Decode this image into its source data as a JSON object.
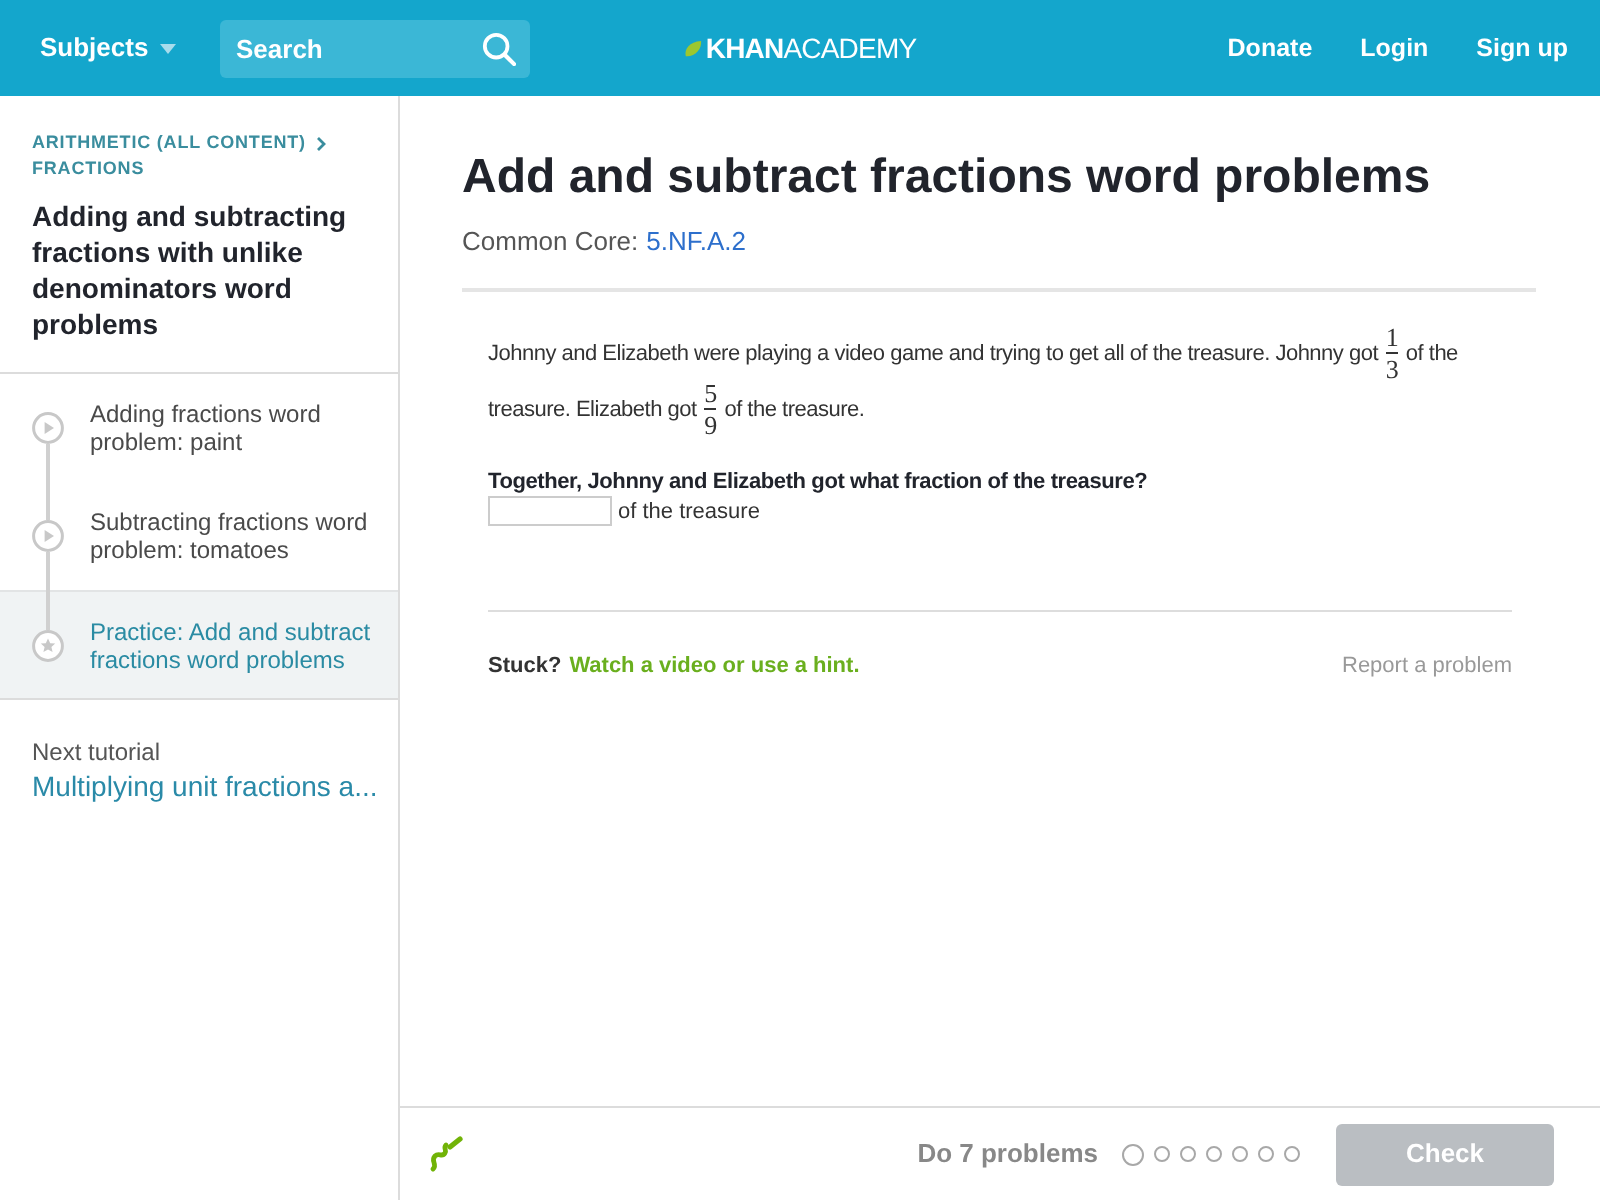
{
  "header": {
    "subjects": "Subjects",
    "search": {
      "placeholder": "Search"
    },
    "logo": "**KHAN**ACADEMY",
    "links": [
      "Donate",
      "Login",
      "Sign up"
    ]
  },
  "sidebar": {
    "breadcrumb": [
      "ARITHMETIC (ALL CONTENT)",
      "FRACTIONS"
    ],
    "title": "Adding and subtracting fractions with unlike denominators word problems",
    "items": [
      {
        "kind": "video",
        "label": "Adding fractions word problem: paint",
        "selected": false
      },
      {
        "kind": "video",
        "label": "Subtracting fractions word problem: tomatoes",
        "selected": false
      },
      {
        "kind": "practice",
        "label": "Practice: Add and subtract fractions word problems",
        "selected": true
      }
    ],
    "next": {
      "label": "Next tutorial",
      "title": "Multiplying unit fractions a..."
    }
  },
  "exercise": {
    "title": "Add and subtract fractions word problems",
    "standard": {
      "label": "Common Core:",
      "code": "5.NF.A.2"
    },
    "problem": [
      {
        "kind": "text",
        "text": "Johnny and Elizabeth were playing a video game and trying to get all of the treasure. Johnny got"
      },
      {
        "kind": "fraction",
        "numerator": "1",
        "denominator": "3"
      },
      {
        "kind": "text",
        "text": "of the treasure. Elizabeth got"
      },
      {
        "kind": "fraction",
        "numerator": "5",
        "denominator": "9"
      },
      {
        "kind": "text",
        "text": "of the treasure."
      }
    ],
    "question": "Together, Johnny and Elizabeth got what fraction of the treasure?",
    "answer": {
      "suffix": "of the treasure"
    },
    "stuck": {
      "label": "Stuck?",
      "link": "Watch a video or use a hint."
    },
    "report": "Report a problem"
  },
  "footer": {
    "goal": "Do 7 problems",
    "progress": [
      {
        "selected": true
      },
      {
        "selected": false
      },
      {
        "selected": false
      },
      {
        "selected": false
      },
      {
        "selected": false
      },
      {
        "selected": false
      },
      {
        "selected": false
      }
    ],
    "check": {
      "label": "Check",
      "disabled": true
    }
  }
}
